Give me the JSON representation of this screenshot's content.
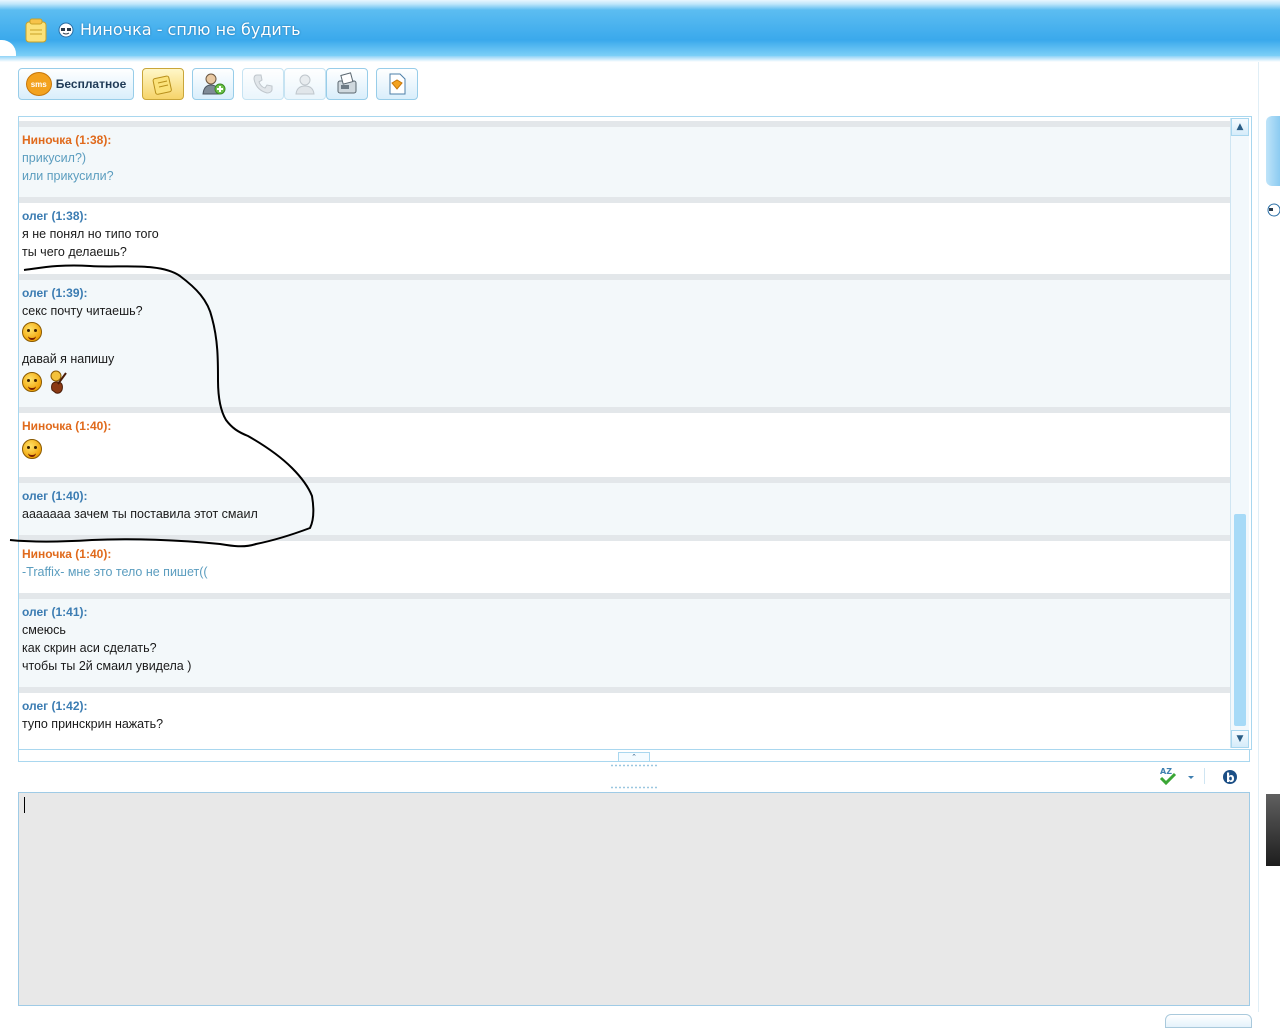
{
  "window": {
    "title": "Ниночка - сплю не будить"
  },
  "toolbar": {
    "sms_label": "Бесплатное",
    "sms_badge": "sms",
    "buttons": [
      {
        "name": "history-button",
        "icon": "notepad-icon"
      },
      {
        "name": "contact-info-button",
        "icon": "user-add-icon"
      },
      {
        "name": "call-button",
        "icon": "phone-icon"
      },
      {
        "name": "video-call-button",
        "icon": "user-icon"
      },
      {
        "name": "fax-button",
        "icon": "fax-icon"
      },
      {
        "name": "send-file-button",
        "icon": "file-icon"
      }
    ]
  },
  "messages": [
    {
      "sender": "Ниночка (1:38):",
      "who": "her",
      "lines": [
        "прикусил?)",
        "или прикусили?"
      ]
    },
    {
      "sender": "олег (1:38):",
      "who": "him",
      "lines": [
        "я не понял но типо того",
        "ты чего делаешь?"
      ]
    },
    {
      "sender": "олег (1:39):",
      "who": "him",
      "lines": [
        "секс почту читаешь?",
        "давай я напишу"
      ],
      "smileys": [
        "smile-icon",
        "smile-icon",
        "guitar-smiley-icon"
      ]
    },
    {
      "sender": "Ниночка (1:40):",
      "who": "her",
      "lines": [],
      "smileys": [
        "laugh-icon"
      ]
    },
    {
      "sender": "олег (1:40):",
      "who": "him",
      "lines": [
        "ааааааа зачем ты поставила этот смаил"
      ]
    },
    {
      "sender": "Ниночка (1:40):",
      "who": "her",
      "lines": [
        "-Traffix- мне это тело не пишет(("
      ]
    },
    {
      "sender": "олег (1:41):",
      "who": "him",
      "lines": [
        "смеюсь",
        "как скрин аси сделать?",
        "чтобы ты 2й смаил увидела )"
      ]
    },
    {
      "sender": "олег (1:42):",
      "who": "him",
      "lines": [
        "тупо принскрин нажать?"
      ]
    }
  ],
  "input": {
    "value": "",
    "tools": [
      "spellcheck-icon",
      "dropdown-arrow-icon",
      "format-icon"
    ]
  },
  "colors": {
    "title_gradient": "#3aa9ec",
    "her_name": "#e06a1c",
    "her_text": "#5b9dbf",
    "him_name": "#3b7cb2",
    "him_text": "#1a1a1a",
    "input_bg": "#e8e8e8"
  }
}
